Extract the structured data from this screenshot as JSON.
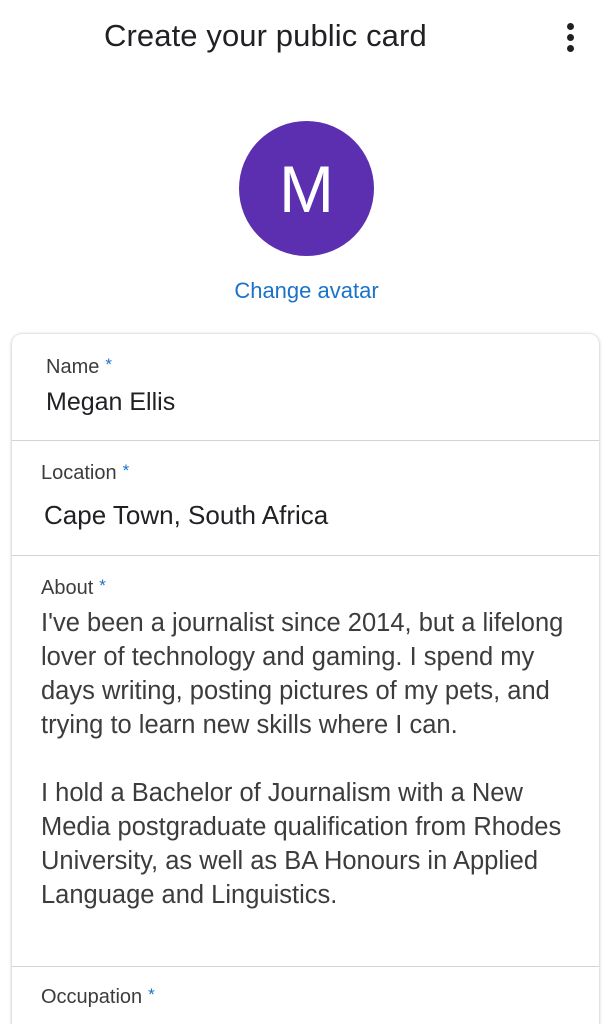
{
  "header": {
    "title": "Create your public card",
    "menu_icon": "more-vert-icon"
  },
  "avatar": {
    "initial": "M",
    "color": "#5b2fb0",
    "change_label": "Change avatar"
  },
  "accent_color": "#1a73c8",
  "form": {
    "required_marker": "*",
    "name": {
      "label": "Name",
      "value": "Megan Ellis"
    },
    "location": {
      "label": "Location",
      "value": "Cape Town, South Africa"
    },
    "about": {
      "label": "About",
      "value": "I've been a journalist since 2014, but a lifelong lover of technology and gaming. I spend my days writing, posting pictures of my pets, and trying to learn new skills where I can.\n\nI hold a Bachelor of Journalism with a New Media postgraduate qualification from Rhodes University, as well as BA Honours in Applied Language and Linguistics."
    },
    "occupation": {
      "label": "Occupation"
    }
  }
}
